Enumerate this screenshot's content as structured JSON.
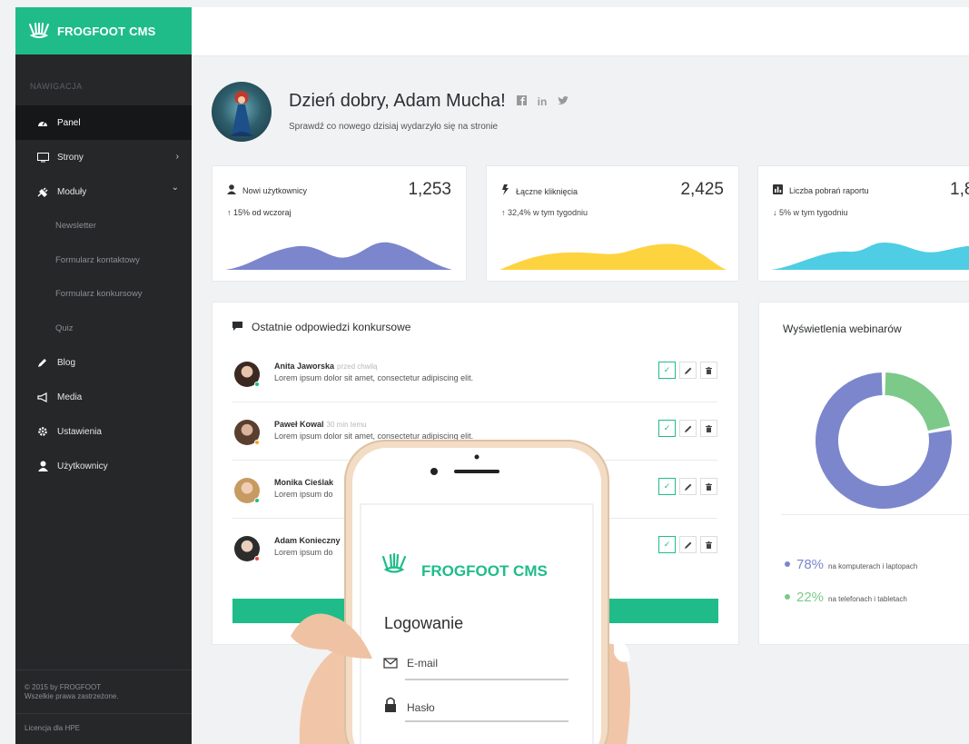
{
  "brand": {
    "name": "FROGFOOT CMS",
    "accent": "#1fbc8a"
  },
  "sidebar": {
    "heading": "NAWIGACJA",
    "items": [
      {
        "label": "Panel",
        "icon": "dashboard-icon",
        "active": true
      },
      {
        "label": "Strony",
        "icon": "monitor-icon",
        "chevron": "›"
      },
      {
        "label": "Moduły",
        "icon": "plug-icon",
        "chevron": "⌄"
      },
      {
        "label": "Blog",
        "icon": "pencil-icon"
      },
      {
        "label": "Media",
        "icon": "megaphone-icon"
      },
      {
        "label": "Ustawienia",
        "icon": "gear-icon"
      },
      {
        "label": "Użytkownicy",
        "icon": "user-icon"
      }
    ],
    "subitems": [
      "Newsletter",
      "Formularz kontaktowy",
      "Formularz konkursowy",
      "Quiz"
    ],
    "footer_line1": "© 2015 by FROGFOOT",
    "footer_line2": "Wszelkie prawa zastrzeżone.",
    "license": "Licencja dla HPE"
  },
  "header": {
    "greeting": "Dzień dobry, Adam Mucha!",
    "subtitle": "Sprawdź co nowego dzisiaj wydarzyło się na stronie",
    "social": [
      "facebook-icon",
      "linkedin-icon",
      "twitter-icon"
    ]
  },
  "stats": [
    {
      "label": "Nowi użytkownicy",
      "value": "1,253",
      "delta": "↑ 15% od wczoraj",
      "color": "#7b86cc",
      "icon": "user-icon"
    },
    {
      "label": "Łączne kliknięcia",
      "value": "2,425",
      "delta": "↑ 32,4% w tym tygodniu",
      "color": "#fdd33f",
      "icon": "cursor-icon"
    },
    {
      "label": "Liczba pobrań raportu",
      "value": "1,8",
      "delta": "↓ 5% w tym tygodniu",
      "color": "#4fcde4",
      "icon": "bar-chart-icon"
    }
  ],
  "answers": {
    "title": "Ostatnie odpowiedzi konkursowe",
    "rows": [
      {
        "name": "Anita Jaworska",
        "time": "przed chwilą",
        "text": "Lorem ipsum dolor sit amet, consectetur adipiscing elit.",
        "status": "#1fbc8a"
      },
      {
        "name": "Paweł Kowal",
        "time": "30 min temu",
        "text": "Lorem ipsum dolor sit amet, consectetur adipiscing elit.",
        "status": "#f5a623"
      },
      {
        "name": "Monika Cieślak",
        "time": "",
        "text": "Lorem ipsum do",
        "status": "#1fbc8a"
      },
      {
        "name": "Adam Konieczny",
        "time": "",
        "text": "Lorem ipsum do",
        "status": "#e54a3a"
      }
    ]
  },
  "webinars": {
    "title": "Wyświetlenia webinarów",
    "legend": [
      {
        "pct": "78%",
        "label": "na komputerach i laptopach",
        "color": "#7b86cc"
      },
      {
        "pct": "22%",
        "label": "na telefonach i tabletach",
        "color": "#7cc98a"
      }
    ]
  },
  "phone": {
    "brand": "FROGFOOT CMS",
    "login_title": "Logowanie",
    "email_placeholder": "E-mail",
    "password_placeholder": "Hasło"
  }
}
